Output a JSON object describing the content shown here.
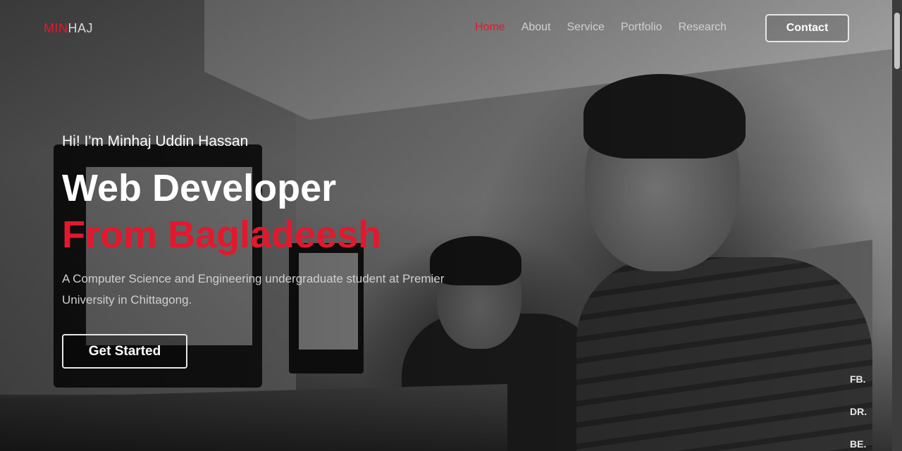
{
  "header": {
    "logo_accent": "MIN",
    "logo_rest": "HAJ",
    "nav": [
      {
        "label": "Home",
        "active": true
      },
      {
        "label": "About",
        "active": false
      },
      {
        "label": "Service",
        "active": false
      },
      {
        "label": "Portfolio",
        "active": false
      },
      {
        "label": "Research",
        "active": false
      }
    ],
    "contact_label": "Contact"
  },
  "hero": {
    "intro": "Hi! I'm Minhaj Uddin Hassan",
    "title_line1": "Web Developer",
    "title_line2": "From Bagladeesh",
    "description": "A Computer Science and Engineering undergraduate student at Premier University in Chittagong.",
    "cta_label": "Get Started"
  },
  "side_labels": [
    "FB.",
    "DR.",
    "BE."
  ],
  "colors": {
    "accent": "#e3182d",
    "text": "#ffffff",
    "muted": "#cfcfcf"
  }
}
